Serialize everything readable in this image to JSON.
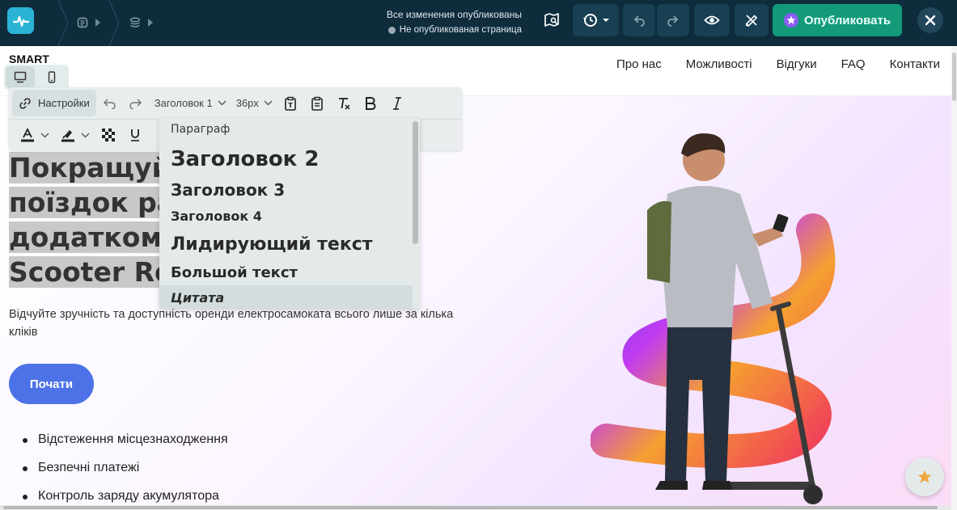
{
  "editor": {
    "status_published": "Все изменения опубликованы",
    "status_unpublished": "Не опубликованая страница",
    "publish_label": "Опубликовать",
    "icons": [
      "pulse-icon",
      "page-icon",
      "layers-icon",
      "map-search-icon",
      "history-icon",
      "undo-icon",
      "redo-icon",
      "eye-icon",
      "design-tools-icon",
      "star-icon",
      "close-icon"
    ]
  },
  "site": {
    "brand": "SMART",
    "nav": [
      "Про нас",
      "Можливості",
      "Відгуки",
      "FAQ",
      "Контакти"
    ],
    "hero_title_lines": [
      "Покращуйт                    від",
      "поїздок ра",
      "додатком S",
      "Scooter Re"
    ],
    "hero_subtitle": "Відчуйте зручність та доступність оренди електросамоката всього лише за кілька кліків",
    "cta_label": "Почати",
    "features": [
      "Відстеження місцезнаходження",
      "Безпечні платежі",
      "Контроль заряду акумулятора"
    ]
  },
  "rich_toolbar": {
    "settings_label": "Настройки",
    "block_type": "Заголовок 1",
    "font_size": "36px"
  },
  "dropdown": {
    "items": [
      "Параграф",
      "Заголовок 2",
      "Заголовок 3",
      "Заголовок 4",
      "Лидирующий текст",
      "Большой текст",
      "Цитата"
    ],
    "highlighted": "Цитата"
  },
  "colors": {
    "topbar": "#0f2c3c",
    "accent": "#2bb3d6",
    "publish": "#129a79",
    "cta": "#4d72e8"
  }
}
